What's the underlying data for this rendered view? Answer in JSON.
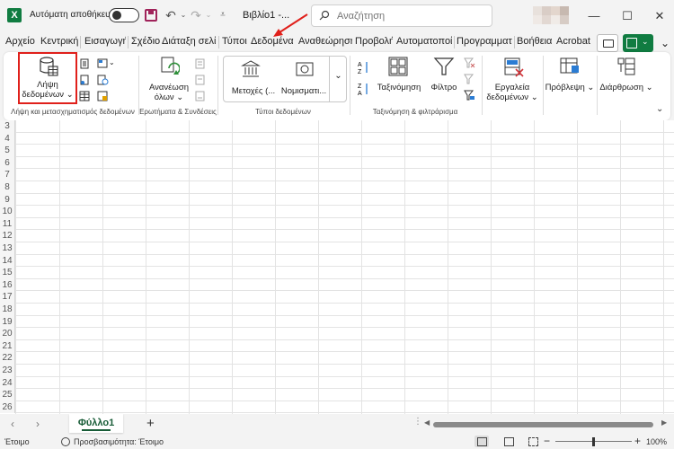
{
  "titlebar": {
    "app_icon": "excel-logo",
    "app_letter": "X",
    "autosave_label": "Αυτόματη αποθήκευση",
    "autosave_on": false,
    "doc_title": "Βιβλίο1 -...",
    "search_placeholder": "Αναζήτηση",
    "qat": {
      "save": "save-icon",
      "undo": "↶",
      "redo": "↷",
      "caret": "⌄",
      "customize": "⩡"
    },
    "window_buttons": {
      "minimize": "—",
      "maximize": "☐",
      "close": "✕"
    }
  },
  "tabs": [
    {
      "label": "Αρχείο"
    },
    {
      "label": "Κεντρική"
    },
    {
      "label": "Εισαγωγή"
    },
    {
      "label": "Σχέδιο"
    },
    {
      "label": "Διάταξη σελίδ"
    },
    {
      "label": "Τύποι"
    },
    {
      "label": "Δεδομένα",
      "active": true
    },
    {
      "label": "Αναθεώρηση"
    },
    {
      "label": "Προβολή"
    },
    {
      "label": "Αυτοματοποί"
    },
    {
      "label": "Προγραμματ"
    },
    {
      "label": "Βοήθεια"
    },
    {
      "label": "Acrobat"
    }
  ],
  "ribbon": {
    "get_data": {
      "line1": "Λήψη",
      "line2": "δεδομένων ⌄"
    },
    "refresh": {
      "line1": "Ανανέωση",
      "line2": "όλων ⌄"
    },
    "stocks": "Μετοχές (...",
    "currencies": "Νομισματι...",
    "sort": "Ταξινόμηση",
    "filter": "Φίλτρο",
    "data_tools": {
      "line1": "Εργαλεία",
      "line2": "δεδομένων ⌄"
    },
    "forecast": "Πρόβλεψη ⌄",
    "outline": "Διάρθρωση ⌄",
    "collapse": "⌄",
    "groups": {
      "get_transform": "Λήψη και μετασχηματισμός δεδομένων",
      "queries": "Ερωτήματα & Συνδέσεις",
      "data_types": "Τύποι δεδομένων",
      "sort_filter": "Ταξινόμηση & φιλτράρισμα"
    }
  },
  "rows": [
    "3",
    "4",
    "5",
    "6",
    "7",
    "8",
    "9",
    "10",
    "11",
    "12",
    "13",
    "14",
    "15",
    "16",
    "17",
    "18",
    "19",
    "20",
    "21",
    "22",
    "23",
    "24",
    "25",
    "26"
  ],
  "sheetbar": {
    "prev": "‹",
    "next": "›",
    "sheet_name": "Φύλλο1",
    "add": "+",
    "dots": "⋮",
    "scroll_left": "◀",
    "scroll_right": "▶"
  },
  "statusbar": {
    "ready": "Έτοιμο",
    "accessibility": "Προσβασιμότητα: Έτοιμο",
    "zoom_minus": "−",
    "zoom_plus": "+",
    "zoom": "100%",
    "zoom_fraction": 0.5
  },
  "colors": {
    "excel_green": "#107c41",
    "accent_green": "#185c37",
    "highlight_red": "#e0201b",
    "autosave_disk": "#a0235a"
  }
}
